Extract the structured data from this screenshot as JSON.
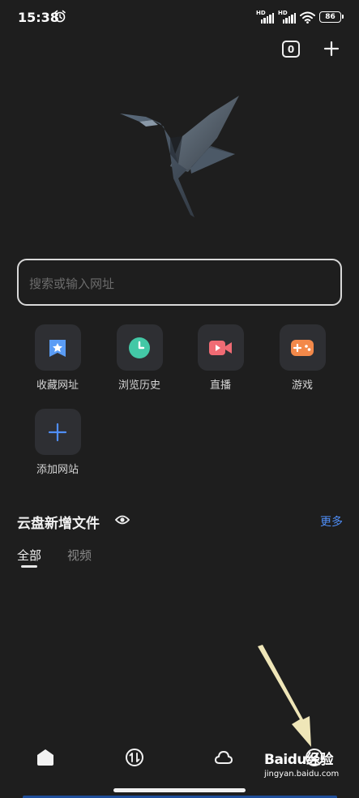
{
  "status_bar": {
    "time": "15:38",
    "network_1": "HD",
    "network_2": "HD",
    "battery": "86"
  },
  "toolbar": {
    "tab_count": "0"
  },
  "search": {
    "placeholder": "搜索或输入网址"
  },
  "shortcuts": [
    {
      "label": "收藏网址",
      "icon": "bookmark-icon",
      "color": "#5a9cf5"
    },
    {
      "label": "浏览历史",
      "icon": "history-clock-icon",
      "color": "#43c8a6"
    },
    {
      "label": "直播",
      "icon": "live-video-icon",
      "color": "#f06b74"
    },
    {
      "label": "游戏",
      "icon": "game-controller-icon",
      "color": "#f3894a"
    },
    {
      "label": "添加网站",
      "icon": "plus-icon",
      "color": "#4f8ef7"
    }
  ],
  "cloud_section": {
    "title": "云盘新增文件",
    "more": "更多",
    "filters": [
      "全部",
      "视频"
    ],
    "active_filter": "全部"
  },
  "bottom_nav": [
    "home-icon",
    "transfer-icon",
    "cloud-icon",
    "profile-icon"
  ],
  "watermark": {
    "brand": "Baidu经验",
    "domain": "jingyan.baidu.com"
  },
  "colors": {
    "background": "#1e1e1e",
    "tile": "#2e2f33",
    "accent": "#4f8ef7"
  }
}
